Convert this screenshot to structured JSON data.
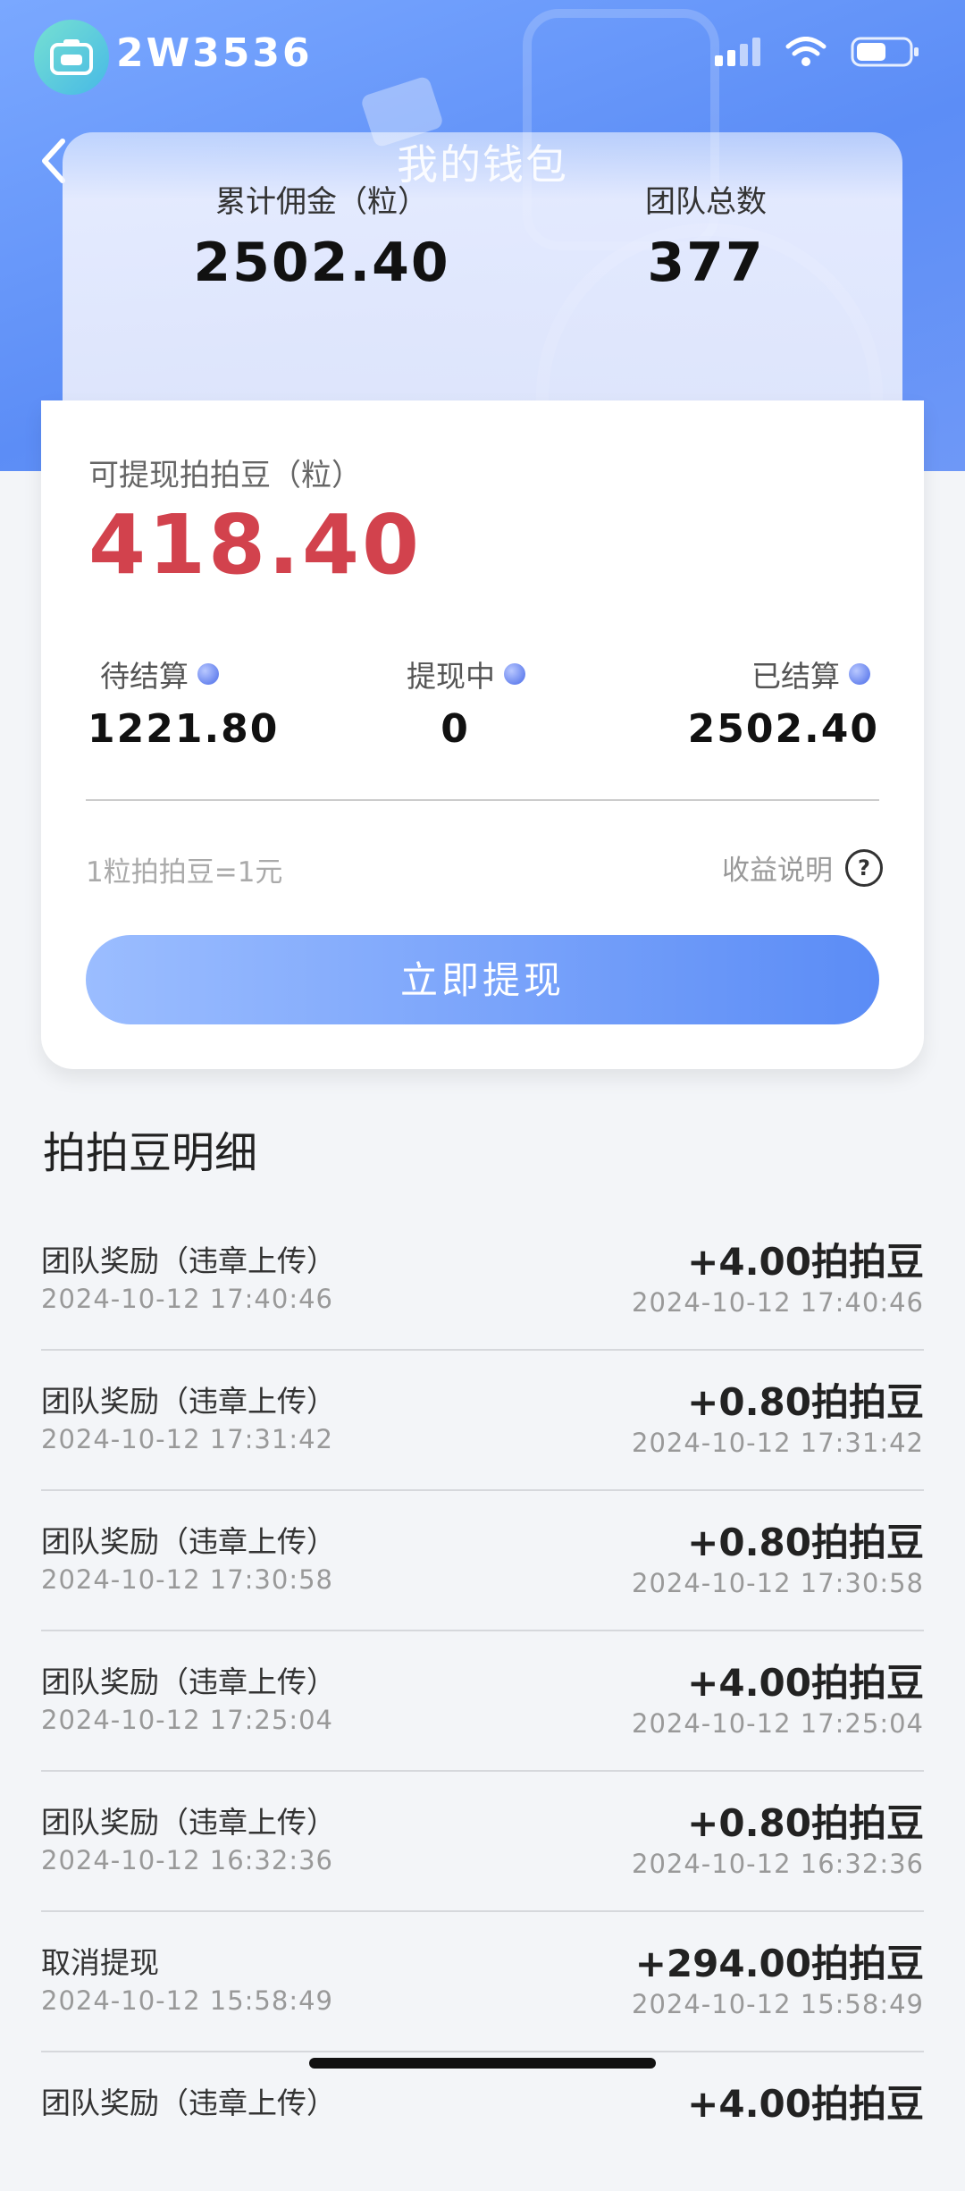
{
  "status_bar": {
    "time": "2W3536"
  },
  "header": {
    "title": "我的钱包"
  },
  "summary": {
    "commission_label": "累计佣金（粒）",
    "commission_value": "2502.40",
    "team_label": "团队总数",
    "team_value": "377"
  },
  "wallet": {
    "available_label": "可提现拍拍豆（粒）",
    "available_value": "418.40",
    "stats": [
      {
        "label": "待结算",
        "value": "1221.80"
      },
      {
        "label": "提现中",
        "value": "0"
      },
      {
        "label": "已结算",
        "value": "2502.40"
      }
    ],
    "rate_text": "1粒拍拍豆=1元",
    "income_note": "收益说明",
    "withdraw_button": "立即提现"
  },
  "transactions": {
    "title": "拍拍豆明细",
    "items": [
      {
        "desc": "团队奖励（违章上传）",
        "time": "2024-10-12 17:40:46",
        "amount": "+4.00拍拍豆"
      },
      {
        "desc": "团队奖励（违章上传）",
        "time": "2024-10-12 17:31:42",
        "amount": "+0.80拍拍豆"
      },
      {
        "desc": "团队奖励（违章上传）",
        "time": "2024-10-12 17:30:58",
        "amount": "+0.80拍拍豆"
      },
      {
        "desc": "团队奖励（违章上传）",
        "time": "2024-10-12 17:25:04",
        "amount": "+4.00拍拍豆"
      },
      {
        "desc": "团队奖励（违章上传）",
        "time": "2024-10-12 16:32:36",
        "amount": "+0.80拍拍豆"
      },
      {
        "desc": "取消提现",
        "time": "2024-10-12 15:58:49",
        "amount": "+294.00拍拍豆"
      },
      {
        "desc": "团队奖励（违章上传）",
        "time": "",
        "amount": "+4.00拍拍豆"
      }
    ]
  },
  "colors": {
    "accent": "#5c8df6",
    "amount_red": "#d2424d"
  }
}
